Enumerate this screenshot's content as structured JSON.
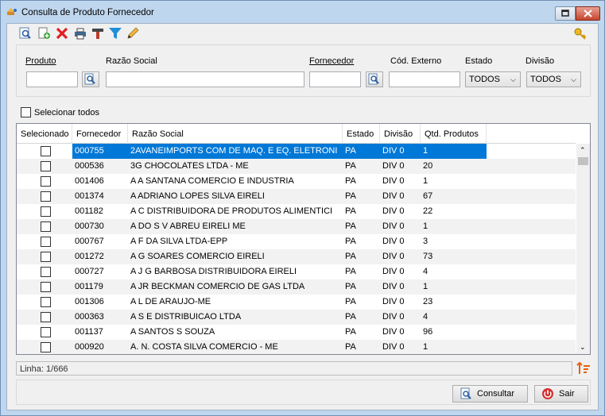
{
  "window": {
    "title": "Consulta de Produto Fornecedor"
  },
  "toolbar": {
    "icons": [
      "search-document-icon",
      "add-document-icon",
      "delete-icon",
      "print-icon",
      "tools-icon",
      "filter-icon",
      "edit-icon"
    ],
    "right_icon": "key-icon"
  },
  "filters": {
    "produto_label": "Produto",
    "produto_value": "",
    "razao_label": "Razão Social",
    "razao_value": "",
    "fornecedor_label": "Fornecedor",
    "fornecedor_value": "",
    "cod_externo_label": "Cód. Externo",
    "cod_externo_value": "",
    "estado_label": "Estado",
    "estado_value": "TODOS",
    "divisao_label": "Divisão",
    "divisao_value": "TODOS"
  },
  "select_all_label": "Selecionar todos",
  "grid": {
    "columns": [
      "Selecionado",
      "Fornecedor",
      "Razão Social",
      "Estado",
      "Divisão",
      "Qtd. Produtos"
    ],
    "rows": [
      {
        "fornecedor": "000755",
        "razao": "2AVANEIMPORTS COM DE MAQ. E EQ. ELETRONI",
        "estado": "PA",
        "divisao": "DIV 0",
        "qtd": "1",
        "selected": true
      },
      {
        "fornecedor": "000536",
        "razao": "3G CHOCOLATES LTDA - ME",
        "estado": "PA",
        "divisao": "DIV 0",
        "qtd": "20"
      },
      {
        "fornecedor": "001406",
        "razao": "A A SANTANA COMERCIO E INDUSTRIA",
        "estado": "PA",
        "divisao": "DIV 0",
        "qtd": "1"
      },
      {
        "fornecedor": "001374",
        "razao": "A ADRIANO LOPES SILVA EIRELI",
        "estado": "PA",
        "divisao": "DIV 0",
        "qtd": "67"
      },
      {
        "fornecedor": "001182",
        "razao": "A C DISTRIBUIDORA DE PRODUTOS ALIMENTICI",
        "estado": "PA",
        "divisao": "DIV 0",
        "qtd": "22"
      },
      {
        "fornecedor": "000730",
        "razao": "A DO S V ABREU EIRELI ME",
        "estado": "PA",
        "divisao": "DIV 0",
        "qtd": "1"
      },
      {
        "fornecedor": "000767",
        "razao": "A F DA SILVA LTDA-EPP",
        "estado": "PA",
        "divisao": "DIV 0",
        "qtd": "3"
      },
      {
        "fornecedor": "001272",
        "razao": "A G SOARES COMERCIO EIRELI",
        "estado": "PA",
        "divisao": "DIV 0",
        "qtd": "73"
      },
      {
        "fornecedor": "000727",
        "razao": "A J G BARBOSA DISTRIBUIDORA EIRELI",
        "estado": "PA",
        "divisao": "DIV 0",
        "qtd": "4"
      },
      {
        "fornecedor": "001179",
        "razao": "A JR BECKMAN COMERCIO DE GAS LTDA",
        "estado": "PA",
        "divisao": "DIV 0",
        "qtd": "1"
      },
      {
        "fornecedor": "001306",
        "razao": "A L DE ARAUJO-ME",
        "estado": "PA",
        "divisao": "DIV 0",
        "qtd": "23"
      },
      {
        "fornecedor": "000363",
        "razao": "A S E DISTRIBUICAO LTDA",
        "estado": "PA",
        "divisao": "DIV 0",
        "qtd": "4"
      },
      {
        "fornecedor": "001137",
        "razao": "A SANTOS S SOUZA",
        "estado": "PA",
        "divisao": "DIV 0",
        "qtd": "96"
      },
      {
        "fornecedor": "000920",
        "razao": "A. N. COSTA SILVA COMERCIO - ME",
        "estado": "PA",
        "divisao": "DIV 0",
        "qtd": "1"
      }
    ]
  },
  "status": {
    "linha": "Linha: 1/666"
  },
  "buttons": {
    "consultar": "Consultar",
    "sair": "Sair"
  },
  "colors": {
    "selection": "#0078d7",
    "title_bg": "#bfd7ee",
    "accent_orange": "#e8600c"
  }
}
